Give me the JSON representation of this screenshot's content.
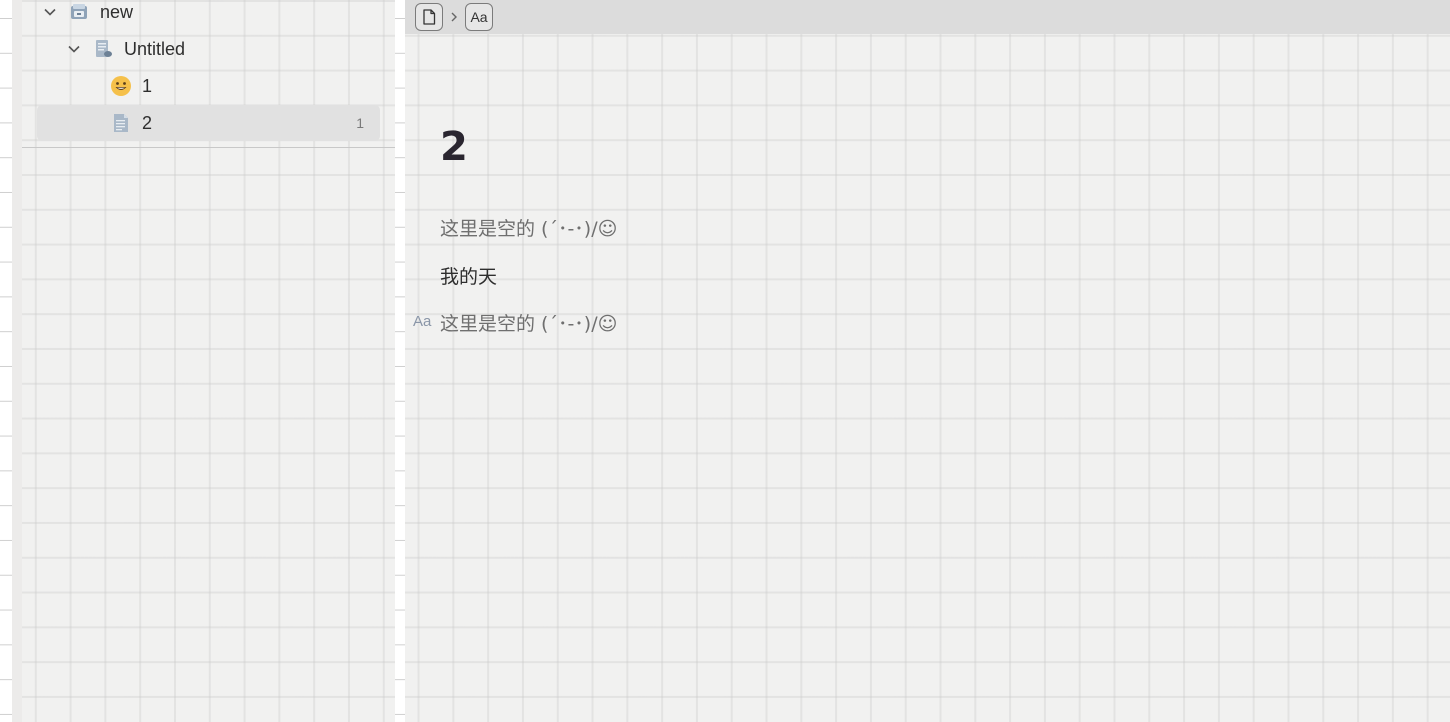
{
  "sidebar": {
    "tree": [
      {
        "label": "new",
        "expanded": true,
        "icon": "workspace-box-icon"
      },
      {
        "label": "Untitled",
        "expanded": true,
        "icon": "document-stack-icon"
      },
      {
        "label": "1",
        "icon": "smiley-emoji-icon"
      },
      {
        "label": "2",
        "icon": "document-icon",
        "count": "1",
        "selected": true
      }
    ]
  },
  "breadcrumb": {
    "doc_icon": "document-icon",
    "separator_icon": "chevron-right-icon",
    "block_label": "Aa"
  },
  "document": {
    "title": "2",
    "blocks": [
      {
        "type": "placeholder",
        "text": "这里是空的 (´･-･)/☺"
      },
      {
        "type": "text",
        "text": "我的天"
      },
      {
        "type": "placeholder",
        "text": "这里是空的 (´･-･)/☺",
        "handle": "Aa"
      }
    ]
  },
  "colors": {
    "background": "#f1f1f0",
    "topbar": "#dcdcdc",
    "selected_row": "#e1e1e1",
    "handle": "#8a96a8"
  }
}
